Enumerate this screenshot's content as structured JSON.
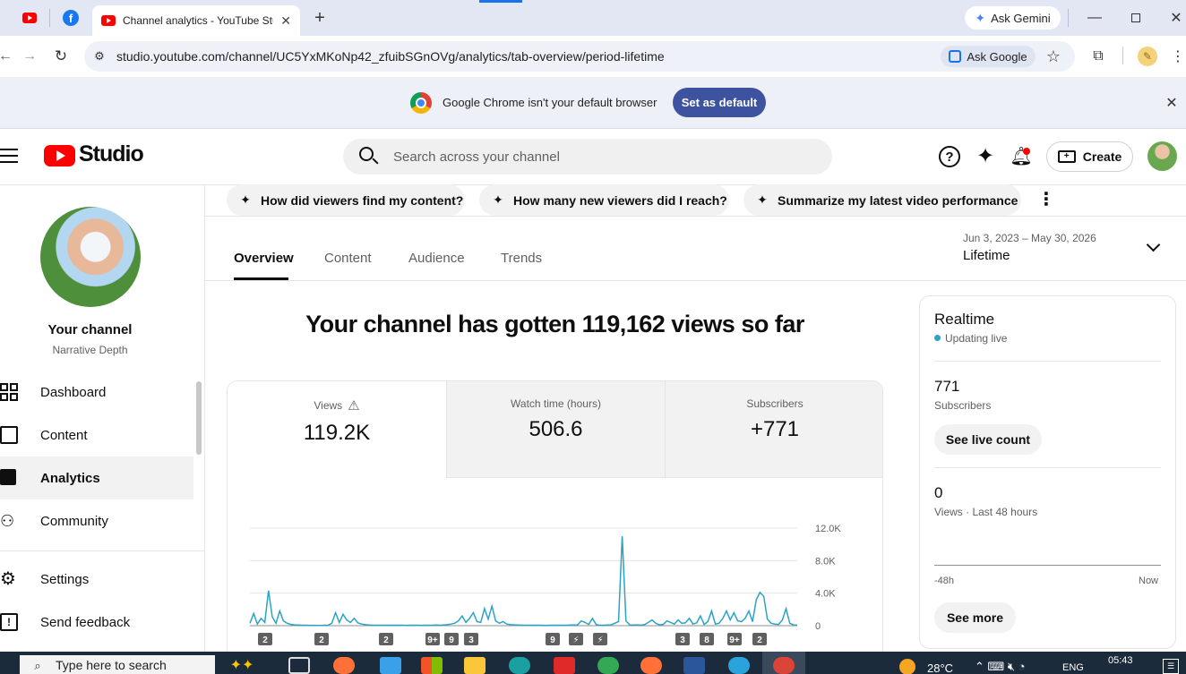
{
  "browser": {
    "active_tab_title": "Channel analytics - YouTube Stu",
    "ask_gemini": "Ask Gemini",
    "url": "studio.youtube.com/channel/UC5YxMKoNp42_zfuibSGnOVg/analytics/tab-overview/period-lifetime",
    "ask_google": "Ask Google"
  },
  "infobar": {
    "message": "Google Chrome isn't your default browser",
    "button": "Set as default"
  },
  "studio": {
    "logo_text": "Studio",
    "search_placeholder": "Search across your channel",
    "create_label": "Create"
  },
  "sidebar": {
    "channel_label": "Your channel",
    "channel_name": "Narrative Depth",
    "items": [
      {
        "label": "Dashboard"
      },
      {
        "label": "Content"
      },
      {
        "label": "Analytics"
      },
      {
        "label": "Community"
      },
      {
        "label": "Settings"
      },
      {
        "label": "Send feedback"
      }
    ]
  },
  "chips": [
    {
      "label": "How did viewers find my content?"
    },
    {
      "label": "How many new viewers did I reach?"
    },
    {
      "label": "Summarize my latest video performance"
    }
  ],
  "tabs": [
    {
      "label": "Overview"
    },
    {
      "label": "Content"
    },
    {
      "label": "Audience"
    },
    {
      "label": "Trends"
    }
  ],
  "period": {
    "range": "Jun 3, 2023 – May 30, 2026",
    "label": "Lifetime"
  },
  "headline": "Your channel has gotten 119,162 views so far",
  "metrics": [
    {
      "label": "Views",
      "value": "119.2K"
    },
    {
      "label": "Watch time (hours)",
      "value": "506.6"
    },
    {
      "label": "Subscribers",
      "value": "+771"
    }
  ],
  "realtime": {
    "title": "Realtime",
    "status": "Updating live",
    "subs_value": "771",
    "subs_label": "Subscribers",
    "live_count_btn": "See live count",
    "views_value": "0",
    "views_label": "Views · Last 48 hours",
    "axis_start": "-48h",
    "axis_end": "Now",
    "see_more": "See more"
  },
  "taskbar": {
    "search_placeholder": "Type here to search",
    "weather": "28°C",
    "lang": "ENG",
    "time": "05:43"
  },
  "colors": {
    "accent_line": "#2ba3c6",
    "set_default_bg": "#3d53a0",
    "youtube_red": "#ff0000"
  },
  "chart_data": {
    "type": "line",
    "ylabel": "",
    "ylim": [
      0,
      12000
    ],
    "yticks": [
      "12.0K",
      "8.0K",
      "4.0K",
      "0"
    ],
    "ytick_values": [
      12000,
      8000,
      4000,
      0
    ],
    "values": [
      300,
      1500,
      200,
      900,
      400,
      4300,
      1100,
      300,
      1800,
      600,
      300,
      150,
      100,
      80,
      60,
      50,
      40,
      40,
      30,
      30,
      50,
      60,
      300,
      1600,
      400,
      1400,
      700,
      400,
      900,
      350,
      200,
      120,
      90,
      70,
      60,
      60,
      50,
      50,
      50,
      60,
      60,
      50,
      40,
      50,
      50,
      60,
      40,
      50,
      60,
      50,
      80,
      60,
      90,
      120,
      200,
      300,
      600,
      1200,
      400,
      900,
      1600,
      500,
      400,
      2100,
      800,
      2400,
      600,
      300,
      500,
      200,
      120,
      100,
      80,
      70,
      60,
      60,
      50,
      50,
      50,
      40,
      40,
      50,
      60,
      60,
      50,
      50,
      80,
      90,
      100,
      600,
      400,
      150,
      900,
      120,
      60,
      60,
      80,
      100,
      300,
      500,
      11000,
      600,
      100,
      80,
      100,
      70,
      120,
      400,
      700,
      300,
      100,
      150,
      600,
      400,
      200,
      700,
      300,
      350,
      900,
      200,
      350,
      1200,
      150,
      500,
      1800,
      200,
      300,
      900,
      1800,
      700,
      1600,
      600,
      500,
      900,
      1800,
      500,
      3200,
      4100,
      3600,
      800,
      300,
      200,
      150,
      700,
      2100,
      300,
      100,
      60
    ]
  },
  "badges": [
    "2",
    "2",
    "2",
    "9+",
    "9",
    "3",
    "9",
    "3",
    "8",
    "9+",
    "2"
  ]
}
